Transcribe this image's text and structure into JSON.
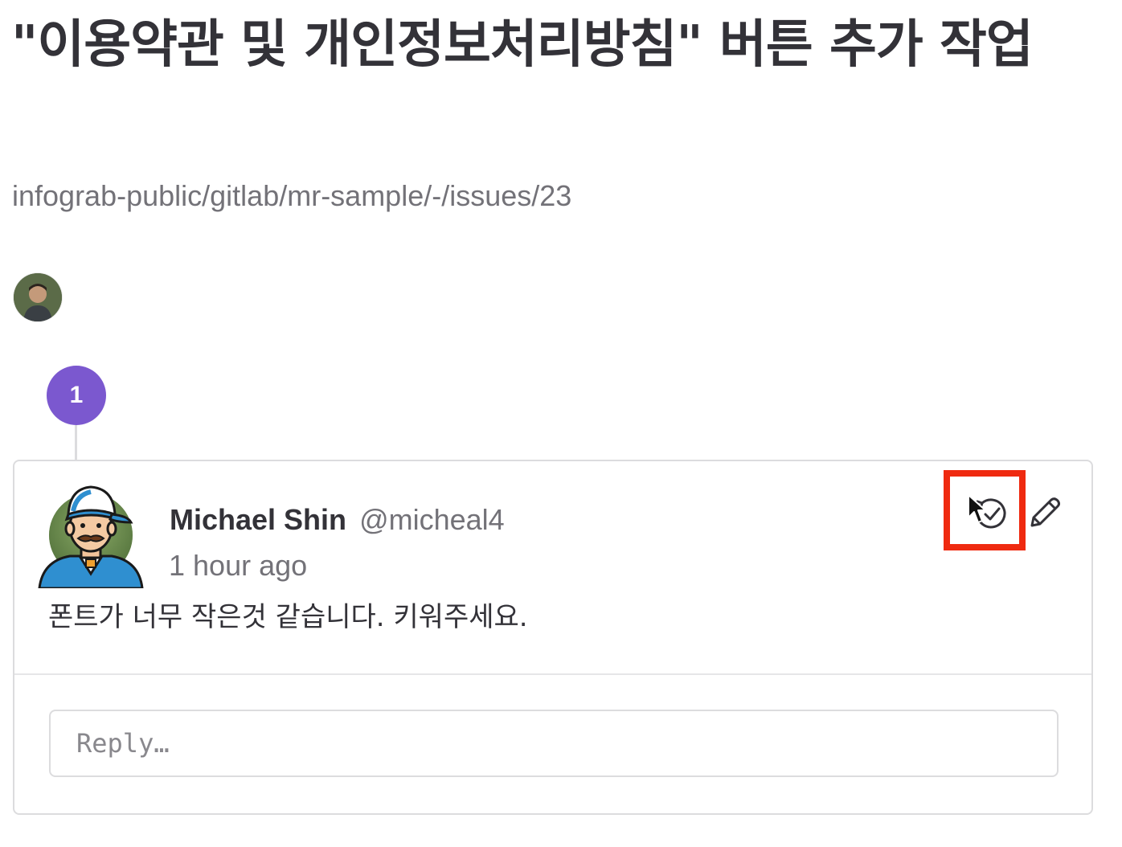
{
  "issue": {
    "title": "\"이용약관 및 개인정보처리방침\" 버튼 추가 작업",
    "path": "infograb-public/gitlab/mr-sample/-/issues/23"
  },
  "timeline": {
    "badge_number": "1",
    "badge_color": "#7b58cf"
  },
  "note": {
    "author_name": "Michael Shin",
    "author_handle": "@micheal4",
    "time_ago": "1 hour ago",
    "body": "폰트가 너무 작은것 같습니다. 키워주세요.",
    "actions": [
      {
        "name": "resolve-thread",
        "icon": "check-circle-icon"
      },
      {
        "name": "edit-comment",
        "icon": "pencil-icon"
      }
    ]
  },
  "reply": {
    "placeholder": "Reply…",
    "value": ""
  },
  "colors": {
    "highlight": "#ef2a10",
    "text": "#333238",
    "secondary_text": "#737278",
    "border": "#dcdcde"
  }
}
